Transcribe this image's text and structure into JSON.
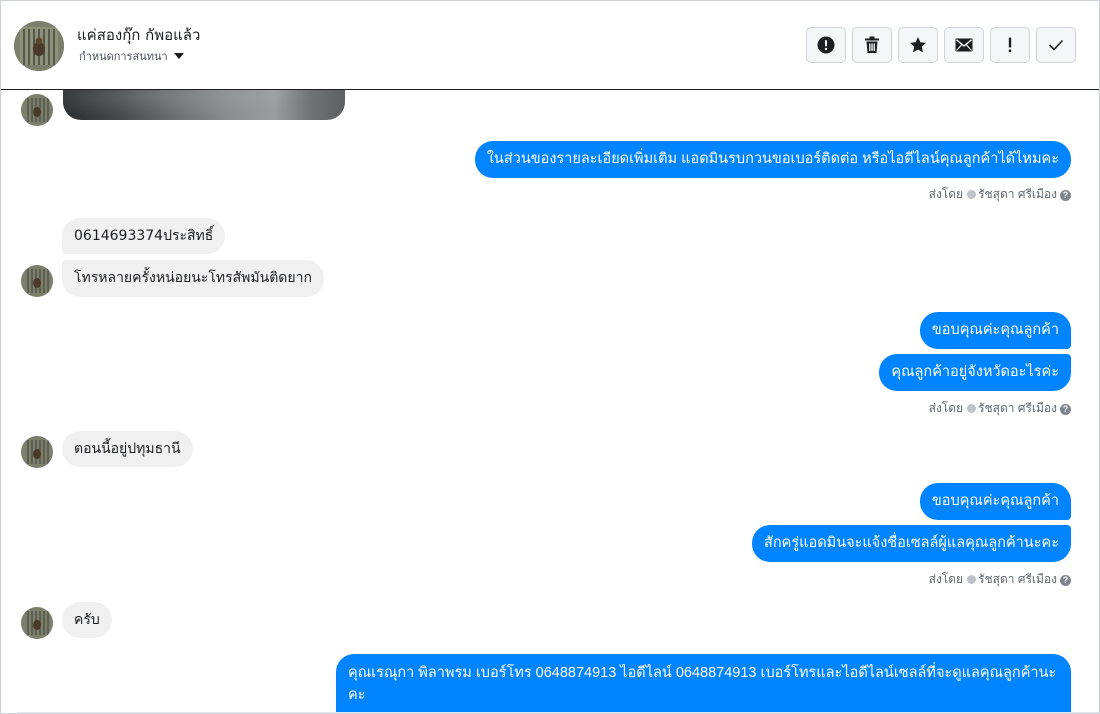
{
  "header": {
    "name": "แค่สองกุ๊ก กัพอแล้ว",
    "subtitle": "กำหนดการสนทนา"
  },
  "toolbar": [
    {
      "name": "spam-button",
      "icon": "alert-circle-icon"
    },
    {
      "name": "delete-button",
      "icon": "trash-icon"
    },
    {
      "name": "star-button",
      "icon": "star-icon"
    },
    {
      "name": "mark-unread-button",
      "icon": "envelope-icon"
    },
    {
      "name": "important-button",
      "icon": "exclamation-icon"
    },
    {
      "name": "done-button",
      "icon": "checkmark-icon"
    }
  ],
  "messages": {
    "out1": "ในส่วนของรายละเอียดเพิ่มเติม แอดมินรบกวนขอเบอร์ติดต่อ หรือไอดีไลน์คุณลูกค้าได้ไหมคะ",
    "in1": "0614693374ประสิทธิ์",
    "in2": "โทรหลายครั้งหน่อยนะโทรสัพมันติดยาก",
    "out2": "ขอบคุณค่ะคุณลูกค้า",
    "out3": "คุณลูกค้าอยู่จังหวัดอะไรค่ะ",
    "in3": "ตอนนี้อยู่ปทุมธานี",
    "out4": "ขอบคุณค่ะคุณลูกค้า",
    "out5": "สักครู่แอดมินจะแจ้งชื่อเซลล์ผู้แลคุณลูกค้านะคะ",
    "in4": "ครับ",
    "out6": "คุณเรณุกา พิลาพรม        เบอร์โทร 0648874913  ไอดีไลน์ 0648874913   เบอร์โทรและไอดีไลน์เซลล์ที่จะดูแลคุณลูกค้านะคะ"
  },
  "sent_by": {
    "prefix": "ส่งโดย",
    "agent": "รัชสุดา ศรีเมือง",
    "help": "?"
  },
  "colors": {
    "outgoing_bubble": "#0084ff",
    "incoming_bubble": "#f1f0f0"
  }
}
